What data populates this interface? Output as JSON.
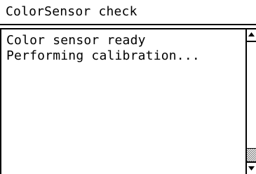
{
  "window": {
    "title": "ColorSensor check"
  },
  "messages": {
    "lines": [
      "Color sensor ready",
      "Performing calibration..."
    ]
  },
  "scrollbar": {
    "up_icon": "triangle-up-icon",
    "down_icon": "triangle-down-icon",
    "position_fraction": 1.0
  },
  "colors": {
    "foreground": "#000000",
    "background": "#ffffff",
    "thumb_pattern": "#808080"
  }
}
